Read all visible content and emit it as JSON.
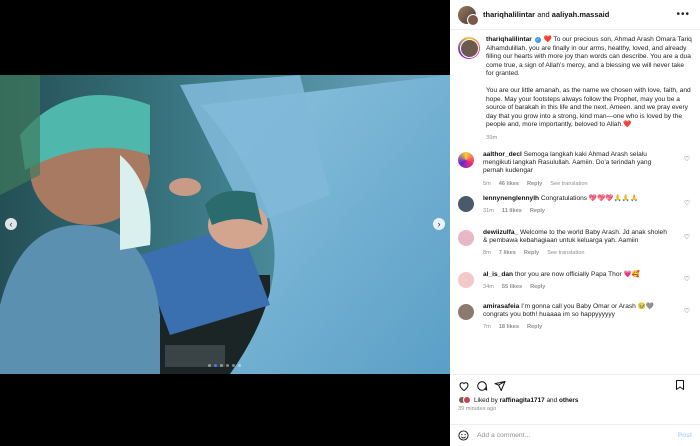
{
  "header": {
    "user1": "thariqhalilintar",
    "connector": "and",
    "user2": "aaliyah.massaid"
  },
  "caption": {
    "username": "thariqhalilintar",
    "opening": "To our precious son, Ahmad Arash Omara Tariq",
    "para1": "Alhamdulillah, you are finally in our arms, healthy, loved, and already filling our hearts with more joy than words can describe. You are a dua come true, a sign of Allah’s mercy, and a blessing we will never take for granted.",
    "para2": "You are our little amanah, as the name we chosen with love, faith, and hope. May your footsteps always follow the Prophet, may you be a source of barakah in this life and the next. Ameen. and we pray every day that you grow into a strong, kind man—one who is loved by the people and, more importantly, beloved to Allah.❤️",
    "time": "39m"
  },
  "comments": [
    {
      "username": "aalthor_decl",
      "text": "Semoga langkah kaki Ahmad Arash selalu mengikuti langkah Rasulullah. Aamiin. Do’a terindah yang pernah kudengar",
      "time": "5m",
      "likes": "46 likes",
      "reply": "Reply",
      "translation": "See translation"
    },
    {
      "username": "lennynenglennylh",
      "text": "Congratulations 💖💖💖🙏🙏🙏",
      "time": "31m",
      "likes": "11 likes",
      "reply": "Reply",
      "translation": ""
    },
    {
      "username": "dewiizulfa_",
      "text": "Welcome to the world Baby Arash. Jd anak sholeh & pembawa kebahagiaan untuk keluarga yah. Aamiin",
      "time": "8m",
      "likes": "7 likes",
      "reply": "Reply",
      "translation": "See translation"
    },
    {
      "username": "al_is_dan",
      "text": "thor you are now officially Papa Thor 💗🥰",
      "time": "34m",
      "likes": "55 likes",
      "reply": "Reply",
      "translation": ""
    },
    {
      "username": "amirasafeia",
      "text": "I’m gonna call you Baby Omar or Arash 🥹🩶 congrats you both! huaaaa im so happyyyyyy",
      "time": "7m",
      "likes": "18 likes",
      "reply": "Reply",
      "translation": ""
    }
  ],
  "likes": {
    "prefix": "Liked by",
    "user": "raffinagita1717",
    "and": "and",
    "others": "others"
  },
  "post_time": "39 minutes ago",
  "add_comment": {
    "placeholder": "Add a comment...",
    "post_label": "Post"
  },
  "colors": {
    "accent": "#3897f0",
    "muted": "#8e8e8e",
    "heart": "#ed4956"
  }
}
